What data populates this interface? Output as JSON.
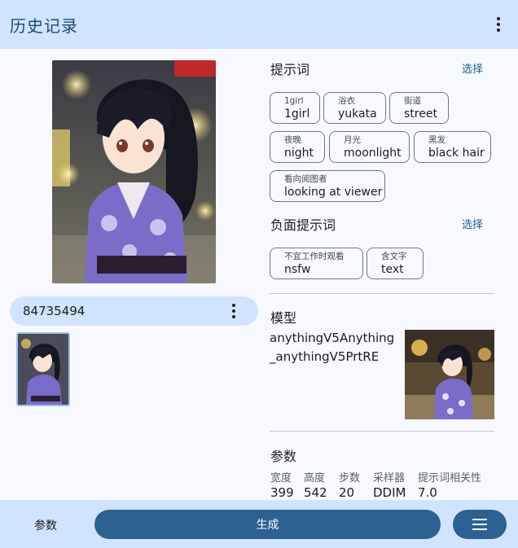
{
  "appbar": {
    "title": "历史记录",
    "menu_icon": "more-vert-icon"
  },
  "seed": {
    "value": "84735494",
    "menu_icon": "more-vert-icon"
  },
  "prompt": {
    "title": "提示词",
    "select_label": "选择",
    "tags": [
      {
        "sub": "1girl",
        "main": "1girl"
      },
      {
        "sub": "浴衣",
        "main": "yukata"
      },
      {
        "sub": "街道",
        "main": "street"
      },
      {
        "sub": "夜晚",
        "main": "night"
      },
      {
        "sub": "月光",
        "main": "moonlight"
      },
      {
        "sub": "黑发",
        "main": "black hair"
      },
      {
        "sub": "看向阅图者",
        "main": "looking at viewer"
      }
    ]
  },
  "negative_prompt": {
    "title": "负面提示词",
    "select_label": "选择",
    "tags": [
      {
        "sub": "不宜工作时观看",
        "main": "nsfw"
      },
      {
        "sub": "含文字",
        "main": "text"
      }
    ]
  },
  "model": {
    "title": "模型",
    "name": "anythingV5Anything_anythingV5PrtRE"
  },
  "params": {
    "title": "参数",
    "headers": [
      "宽度",
      "高度",
      "步数",
      "采样器",
      "提示词相关性"
    ],
    "values": [
      "399",
      "542",
      "20",
      "DDIM",
      "7.0"
    ]
  },
  "bottom": {
    "params_label": "参数",
    "generate_label": "生成",
    "menu_icon": "hamburger-menu-icon"
  },
  "colors": {
    "primary": "#2c6191",
    "container": "#d1e4ff",
    "background": "#f7f9ff"
  }
}
